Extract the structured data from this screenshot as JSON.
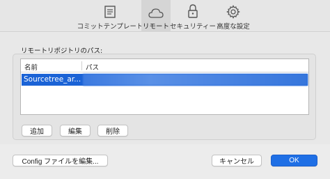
{
  "toolbar": {
    "tabs": [
      {
        "label": "コミットテンプレート",
        "icon": "document-icon"
      },
      {
        "label": "リモート",
        "icon": "cloud-icon",
        "active": true
      },
      {
        "label": "セキュリティー",
        "icon": "lock-icon"
      },
      {
        "label": "高度な設定",
        "icon": "gear-icon"
      }
    ]
  },
  "remotes": {
    "section_label": "リモートリポジトリのパス:",
    "columns": {
      "name": "名前",
      "path": "パス"
    },
    "rows": [
      {
        "name": "Sourcetree_ar...",
        "path": ""
      }
    ],
    "add_label": "追加",
    "edit_label": "編集",
    "delete_label": "削除"
  },
  "footer": {
    "config_label": "Config ファイルを編集...",
    "cancel_label": "キャンセル",
    "ok_label": "OK"
  },
  "colors": {
    "selection": "#1b63d6",
    "primary": "#1f6fe5"
  }
}
